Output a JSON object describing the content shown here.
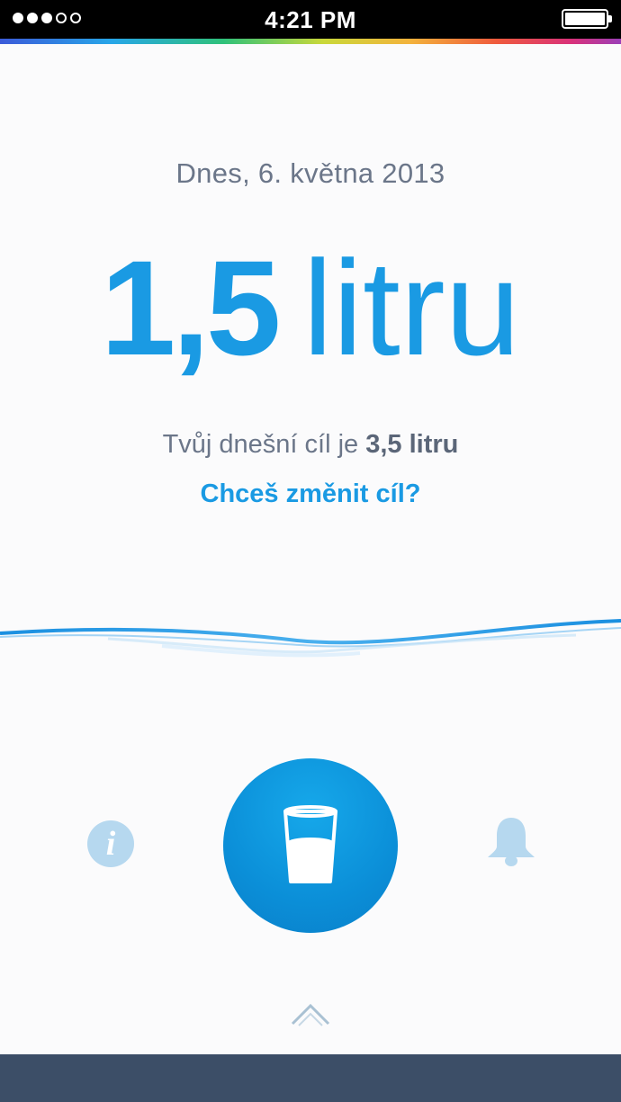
{
  "status_bar": {
    "time": "4:21 PM",
    "signal_dots": 5,
    "signal_dots_filled": 3,
    "battery_level": 1.0
  },
  "main": {
    "date": "Dnes, 6. května 2013",
    "amount_value": "1,5",
    "amount_unit": "litru",
    "goal_prefix": "Tvůj dnešní cíl je",
    "goal_value": "3,5 litru",
    "change_goal_link": "Chceš změnit cíl?"
  },
  "actions": {
    "info_glyph": "i",
    "info_icon": "info-icon",
    "drink_icon": "water-glass-icon",
    "bell_icon": "bell-icon",
    "expand_icon": "chevron-up-icon"
  },
  "colors": {
    "accent": "#1a9ae3",
    "text_muted": "#6b7689",
    "icon_light": "#b6d8ef",
    "bottom_bar": "#3c4e67"
  }
}
